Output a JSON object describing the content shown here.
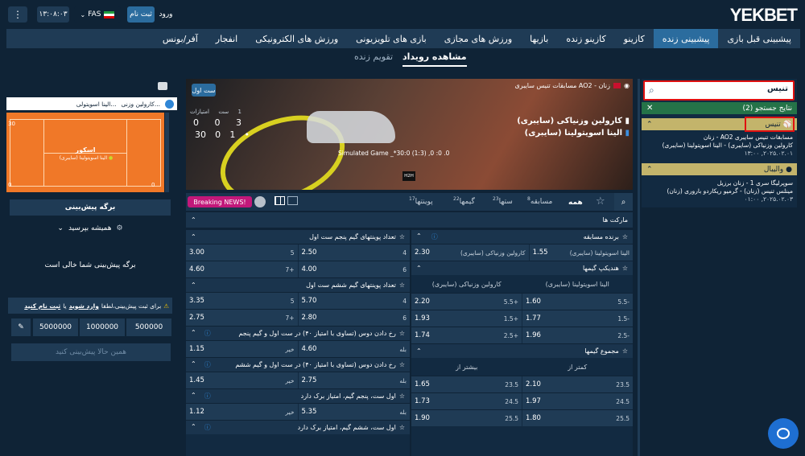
{
  "brand": {
    "logo_yek": "YEK",
    "logo_bet": "BET"
  },
  "topbar": {
    "login": "ورود",
    "signup": "ثبت نام",
    "language": "FAS",
    "time": "۱۳:۰۸:۰۳",
    "menu_icon": "vertical-dots-icon",
    "flag_icon": "iran-flag-icon"
  },
  "nav": [
    {
      "label": "پیشبینی قبل بازی",
      "active": false
    },
    {
      "label": "پیشبینی زنده",
      "active": true
    },
    {
      "label": "کازینو",
      "active": false
    },
    {
      "label": "کازینو زنده",
      "active": false
    },
    {
      "label": "بازیها",
      "active": false
    },
    {
      "label": "ورزش های مجازی",
      "active": false
    },
    {
      "label": "بازی های تلویزیونی",
      "active": false
    },
    {
      "label": "ورزش های الکترونیکی",
      "active": false
    },
    {
      "label": "انفجار",
      "active": false
    },
    {
      "label": "آفر/بونس",
      "active": false
    }
  ],
  "subnav": {
    "events": "مشاهده رویداد",
    "calendar": "تقویم زنده"
  },
  "search": {
    "query": "تنیس"
  },
  "results": {
    "title": "نتایج جستجو (2)",
    "close": "✕",
    "tennis": {
      "label": "تنیس",
      "line1": "مسابقات تنیس سایبری AO2 - زنان",
      "line2": "کارولین وزنیاکی (سایبری) - الینا اسویتولینا (سایبری)",
      "line3": "۲۰۲۵.۰۲.۰۱, ۱۳:۰۰"
    },
    "volleyball": {
      "label": "والیبال",
      "line1": "سوپرلیگا سری 1 - زنان برزیل",
      "line2": "مینلس تنیس (زنان) - گرمیو ریکاردو باروری (زنان)",
      "line3": "۲۰۲۵.۰۲.۰۳, ۰۱:۰۰"
    }
  },
  "match": {
    "tournament": "مسابقات تنیس سایبری AO2 - زنان",
    "player1": "کارولین وزنیاکی (سایبری)",
    "player2": "الینا اسویتولینا (سایبری)",
    "live_badge": "ست اول",
    "score_head": {
      "points": "امتیازات",
      "set": "ست",
      "s1": "1"
    },
    "p1_scores": {
      "points": "0",
      "set": "0",
      "s1": "3"
    },
    "p2_scores": {
      "points": "30",
      "set": "0",
      "s1": "1"
    },
    "simulated": "Simulated Game _*30:0 (1:3) ,0 :0 .0",
    "h2h": "H2H"
  },
  "market_tabs": {
    "all": "همه",
    "match": "مسابقه",
    "match_count": "8",
    "sets": "ستها",
    "sets_count": "23",
    "games": "گیمها",
    "games_count": "22",
    "points": "پوینتها",
    "points_count": "17",
    "breaking": "Breaking NEWS!"
  },
  "markets_title": "مارکت ها",
  "right_col": {
    "winner": {
      "title": "برنده مسابقه",
      "p1": "کارولین وزنیاکی (سایبری)",
      "o1": "2.30",
      "p2": "الینا اسویتولینا (سایبری)",
      "o2": "1.55"
    },
    "handicap": {
      "title": "هندیکپ گیمها",
      "h1": "کارولین وزنیاکی (سایبری)",
      "h2": "الینا اسویتولینا (سایبری)",
      "rows": [
        {
          "l1": "5.5+",
          "v1": "2.20",
          "l2": "5.5-",
          "v2": "1.60"
        },
        {
          "l1": "1.5+",
          "v1": "1.93",
          "l2": "1.5-",
          "v2": "1.77"
        },
        {
          "l1": "2.5+",
          "v1": "1.74",
          "l2": "2.5-",
          "v2": "1.96"
        }
      ]
    },
    "total": {
      "title": "مجموع گیمها",
      "h1": "بیشتر از",
      "h2": "کمتر از",
      "rows": [
        {
          "l1": "23.5",
          "v1": "1.65",
          "l2": "23.5",
          "v2": "2.10"
        },
        {
          "l1": "24.5",
          "v1": "1.73",
          "l2": "24.5",
          "v2": "1.97"
        },
        {
          "l1": "25.5",
          "v1": "1.90",
          "l2": "25.5",
          "v2": "1.80"
        }
      ]
    }
  },
  "left_col": {
    "m1": {
      "title": "تعداد پوینتهای گیم پنجم ست اول",
      "rows": [
        {
          "l1": "4",
          "v1": "2.50",
          "l2": "5",
          "v2": "3.00"
        },
        {
          "l1": "6",
          "v1": "4.00",
          "l2": "7+",
          "v2": "4.60"
        }
      ]
    },
    "m2": {
      "title": "تعداد پوینتهای گیم ششم ست اول",
      "rows": [
        {
          "l1": "4",
          "v1": "5.70",
          "l2": "5",
          "v2": "3.35"
        },
        {
          "l1": "6",
          "v1": "2.80",
          "l2": "7+",
          "v2": "2.75"
        }
      ]
    },
    "m3": {
      "title": "رخ دادن دوس (تساوی با امتیاز ۴۰) در ست اول و گیم پنجم",
      "row": {
        "l1": "بله",
        "v1": "4.60",
        "l2": "خیر",
        "v2": "1.15"
      }
    },
    "m4": {
      "title": "رخ دادن دوس (تساوی با امتیاز ۴۰) در ست اول و گیم ششم",
      "row": {
        "l1": "بله",
        "v1": "2.75",
        "l2": "خیر",
        "v2": "1.45"
      }
    },
    "m5": {
      "title": "اول ست، پنجم گیم، امتیاز برک دارد",
      "row": {
        "l1": "بله",
        "v1": "5.35",
        "l2": "خیر",
        "v2": "1.12"
      }
    },
    "m6": {
      "title": "اول ست، ششم گیم، امتیاز برک دارد"
    }
  },
  "betslip": {
    "mini_p1": "کارولین وزنی...",
    "mini_p2": "الینا اسویتولی...",
    "court_p1": "اسکور",
    "court_p2": "الینا اسویتولینا (سایبری)",
    "court_left": "30",
    "court_right": "0",
    "court_bottom": "0",
    "title": "برگه پیش‌بینی",
    "accept": "همیشه بپرسید",
    "empty": "برگه پیش‌بینی شما خالی است",
    "warn_prefix": "برای ثبت پیش‌بینی،لطفا",
    "login_link": "وارد شوید",
    "or": "یا",
    "signup_link": "ثبت نام کنید",
    "amount1": "500000",
    "amount2": "1000000",
    "amount3": "5000000",
    "submit": "همین حالا پیش‌بینی کنید"
  }
}
